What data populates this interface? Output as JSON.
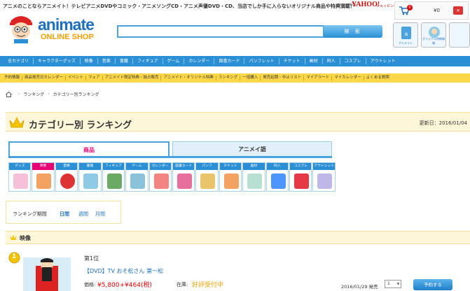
{
  "header": {
    "tagline": "アニメのことならアニメイト！テレビアニメDVDやコミック・アニメソングCD・アニメ声優DVD・CD、当店でしか手に入らないオリジナル商品や特典満載！",
    "powered_by": "powered by",
    "yahoo": "YAHOO!",
    "yahoo_shopping": "ショッピング",
    "logo_main": "animate",
    "logo_sub": "ONLINE SHOP",
    "cart_count": "0",
    "cart_amount": "¥0",
    "search_button": "検 索",
    "side_icon_1": "アニメイト",
    "side_icon_2": "オリジナル特典情報"
  },
  "main_nav": [
    "全カテゴリ",
    "キャラクターグッズ",
    "映像",
    "音楽",
    "書籍",
    "フィギュア",
    "ゲーム",
    "カレンダー",
    "図書カード",
    "パンフレット",
    "チケット",
    "画材",
    "同人",
    "コスプレ",
    "アウトレット"
  ],
  "sub_nav": [
    "予約情報",
    "商品発売日カレンダー",
    "イベント",
    "フェア",
    "アニメイト限定特典・独占販売",
    "アニメイト・オリジナル特典",
    "ランキング",
    "一括購入",
    "発売延期・中止リスト",
    "マイアラート",
    "マイカレンダー",
    "よくある質問"
  ],
  "breadcrumb": {
    "level1": "ランキング",
    "level2": "カテゴリー別ランキング"
  },
  "page": {
    "title": "カテゴリー別 ランキング",
    "updated": "更新日：2016/01/04"
  },
  "tabs": {
    "active": "商品",
    "inactive": "アニメイ語"
  },
  "categories": [
    {
      "label": "グッズ",
      "color": "#f6c1d8"
    },
    {
      "label": "映像",
      "color": "#f4a261"
    },
    {
      "label": "音楽",
      "color": "#d33"
    },
    {
      "label": "書籍",
      "color": "#8ecae6"
    },
    {
      "label": "フィギュア",
      "color": "#6aaa64"
    },
    {
      "label": "ゲーム",
      "color": "#89c2d9"
    },
    {
      "label": "カレンダー",
      "color": "#f28482"
    },
    {
      "label": "図書カード",
      "color": "#e76f9b"
    },
    {
      "label": "パンフ",
      "color": "#e9c46a"
    },
    {
      "label": "チケット",
      "color": "#f4a261"
    },
    {
      "label": "画材",
      "color": "#b8e0d2"
    },
    {
      "label": "同人",
      "color": "#4d96ff"
    },
    {
      "label": "コスプレ",
      "color": "#e63946"
    },
    {
      "label": "アウトレット",
      "color": "#bfb8e6"
    }
  ],
  "period": {
    "label": "ランキング期間",
    "daily": "日間",
    "weekly": "週間",
    "monthly": "月間"
  },
  "section": {
    "title": "映像"
  },
  "product": {
    "rank_number": "1",
    "rank_label": "第1位",
    "name": "【DVD】TV おそ松さん 第一松",
    "price_label": "価格:",
    "price": "¥5,800+¥464(税)",
    "stock_label": "在庫:",
    "stock": "好評受付中",
    "release": "2016/01/29 発売",
    "qty": "1",
    "order_button": "予約する"
  },
  "colors": {
    "nav_blue": "#2a8fd4",
    "nav_yellow": "#ffd84a",
    "accent_pink": "#e60073",
    "price_red": "#e60000",
    "stock_orange": "#f0a000"
  }
}
